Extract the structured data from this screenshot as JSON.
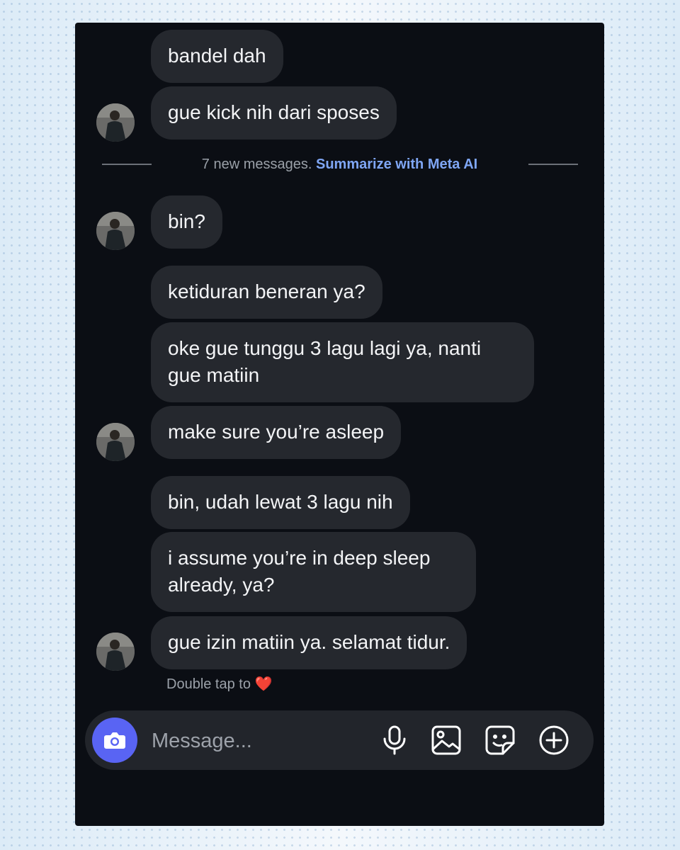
{
  "messages": [
    {
      "text": "bandel dah"
    },
    {
      "text": "gue kick nih dari sposes"
    },
    {
      "text": "bin?"
    },
    {
      "text": "ketiduran beneran ya?"
    },
    {
      "text": "oke gue tunggu 3 lagu lagi ya, nanti gue matiin"
    },
    {
      "text": "make sure you’re asleep"
    },
    {
      "text": "bin, udah lewat 3 lagu nih"
    },
    {
      "text": "i assume you’re in deep sleep already, ya?"
    },
    {
      "text": "gue izin matiin ya. selamat tidur."
    }
  ],
  "divider": {
    "text": "7 new messages.",
    "link": "Summarize with Meta AI"
  },
  "reaction_hint": {
    "text": "Double tap to",
    "emoji": "❤️"
  },
  "composer": {
    "placeholder": "Message...",
    "icons": [
      "camera-icon",
      "microphone-icon",
      "image-icon",
      "sticker-icon",
      "plus-icon"
    ],
    "camera_color": "#5964f3"
  },
  "colors": {
    "background": "#0b0e14",
    "bubble": "#25282e",
    "link": "#7fa6f4"
  }
}
